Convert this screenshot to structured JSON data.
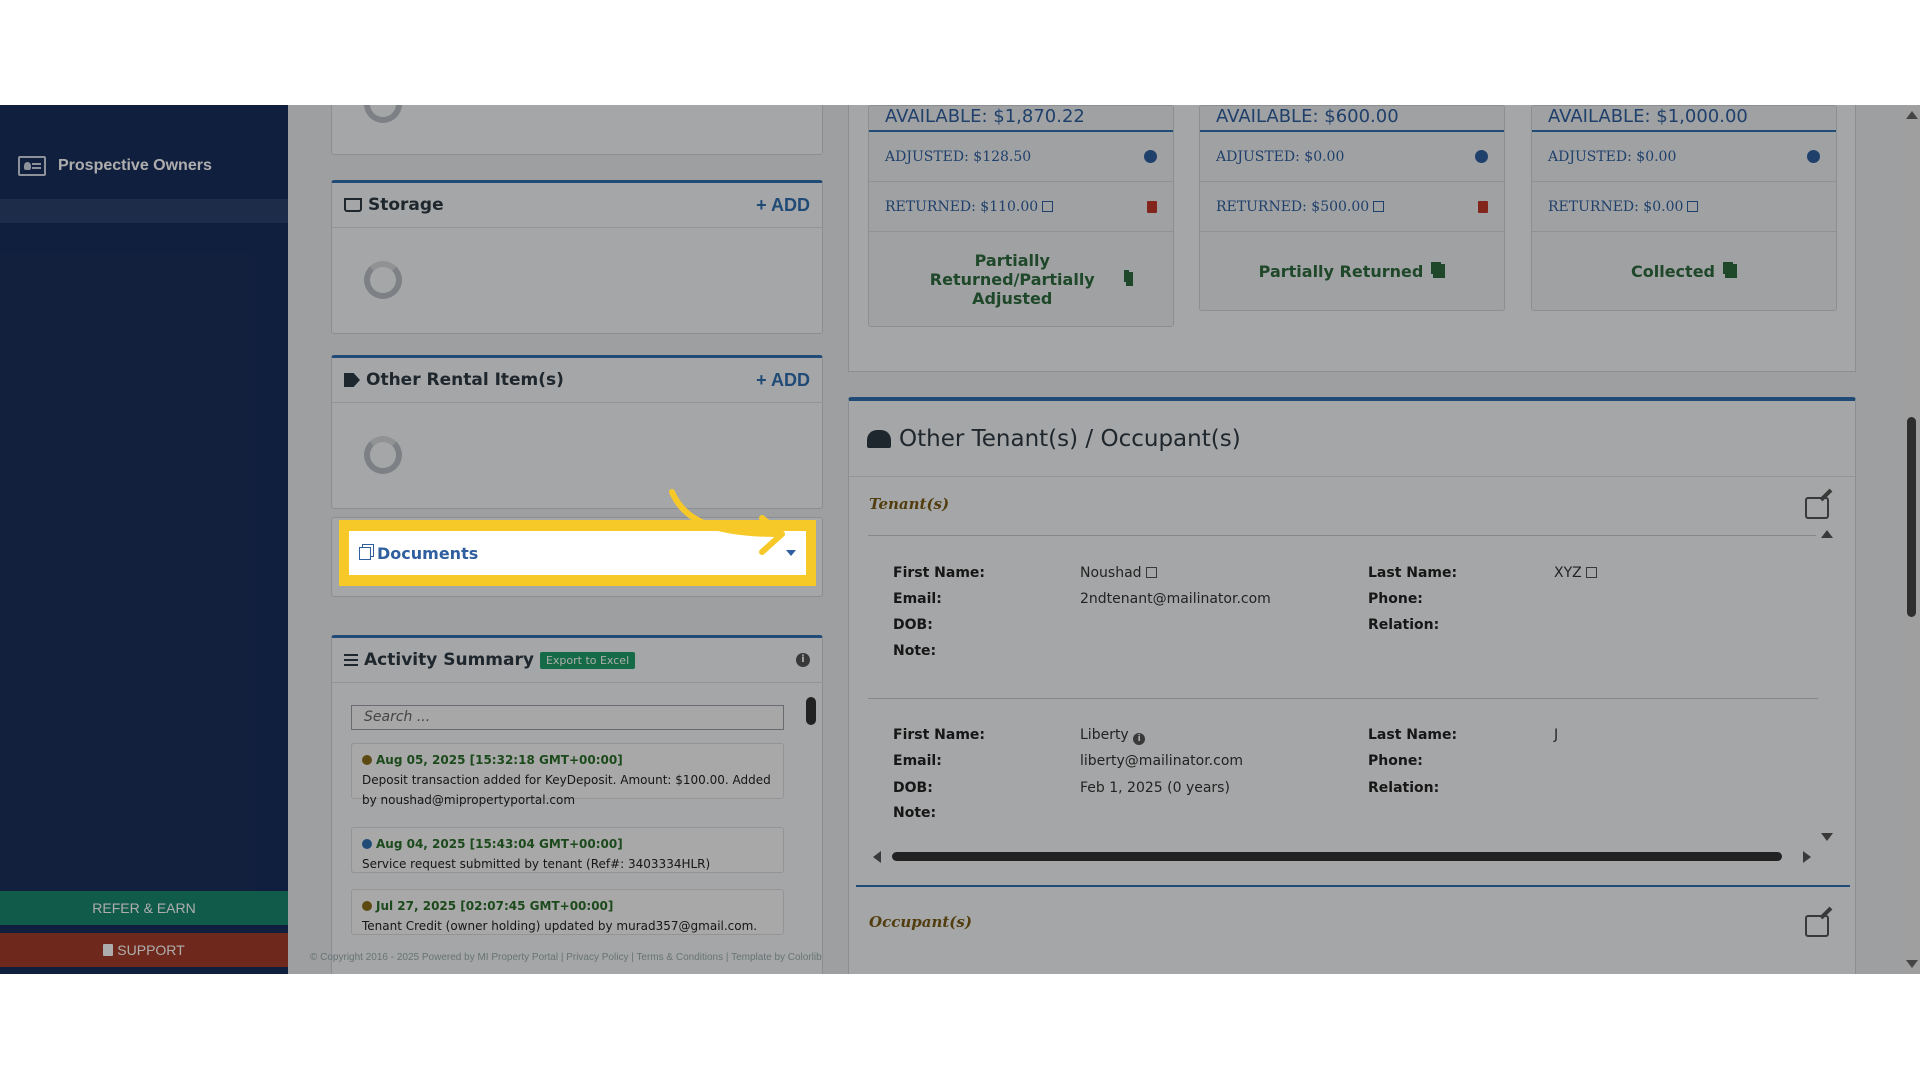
{
  "sidebar": {
    "item_label": "Prospective Owners",
    "refer_label": "REFER & EARN",
    "support_label": "SUPPORT"
  },
  "panels": {
    "storage": {
      "title": "Storage",
      "add": "ADD"
    },
    "other_rental": {
      "title": "Other Rental Item(s)",
      "add": "ADD"
    },
    "documents": {
      "title": "Documents"
    },
    "activity": {
      "title": "Activity Summary",
      "export_label": "Export to Excel",
      "search_placeholder": "Search ...",
      "items": [
        {
          "date": "Aug 05, 2025 [15:32:18 GMT+00:00]",
          "text": "Deposit transaction added for KeyDeposit. Amount: $100.00. Added by noushad@mipropertyportal.com",
          "color": "#8a6d1c"
        },
        {
          "date": "Aug 04, 2025 [15:43:04 GMT+00:00]",
          "text": "Service request submitted by tenant (Ref#: 3403334HLR)",
          "color": "#2f6fae"
        },
        {
          "date": "Jul 27, 2025 [02:07:45 GMT+00:00]",
          "text": "Tenant Credit (owner holding) updated by murad357@gmail.com.",
          "color": "#8a6d1c"
        }
      ]
    }
  },
  "deposit_cards": [
    {
      "available": "AVAILABLE: $1,870.22",
      "adjusted": "ADJUSTED: $128.50",
      "returned": "RETURNED: $110.00",
      "status": "Partially Returned/Partially Adjusted"
    },
    {
      "available": "AVAILABLE: $600.00",
      "adjusted": "ADJUSTED: $0.00",
      "returned": "RETURNED: $500.00",
      "status": "Partially Returned"
    },
    {
      "available": "AVAILABLE: $1,000.00",
      "adjusted": "ADJUSTED: $0.00",
      "returned": "RETURNED: $0.00",
      "status": "Collected"
    }
  ],
  "tenants_panel": {
    "title": "Other Tenant(s) / Occupant(s)",
    "tenants_label": "Tenant(s)",
    "occupants_label": "Occupant(s)",
    "field_labels": {
      "first": "First Name:",
      "last": "Last Name:",
      "email": "Email:",
      "phone": "Phone:",
      "dob": "DOB:",
      "relation": "Relation:",
      "note": "Note:"
    },
    "tenants": [
      {
        "first": "Noushad",
        "last": "XYZ",
        "email": "2ndtenant@mailinator.com",
        "dob": "",
        "phone": "",
        "relation": "",
        "note": ""
      },
      {
        "first": "Liberty",
        "last": "J",
        "email": "liberty@mailinator.com",
        "dob": "Feb 1, 2025 (0 years)",
        "phone": "",
        "relation": "",
        "note": ""
      }
    ]
  },
  "footer": "© Copyright 2016 - 2025 Powered by MI Property Portal | Privacy Policy | Terms & Conditions | Template by Colorlib"
}
